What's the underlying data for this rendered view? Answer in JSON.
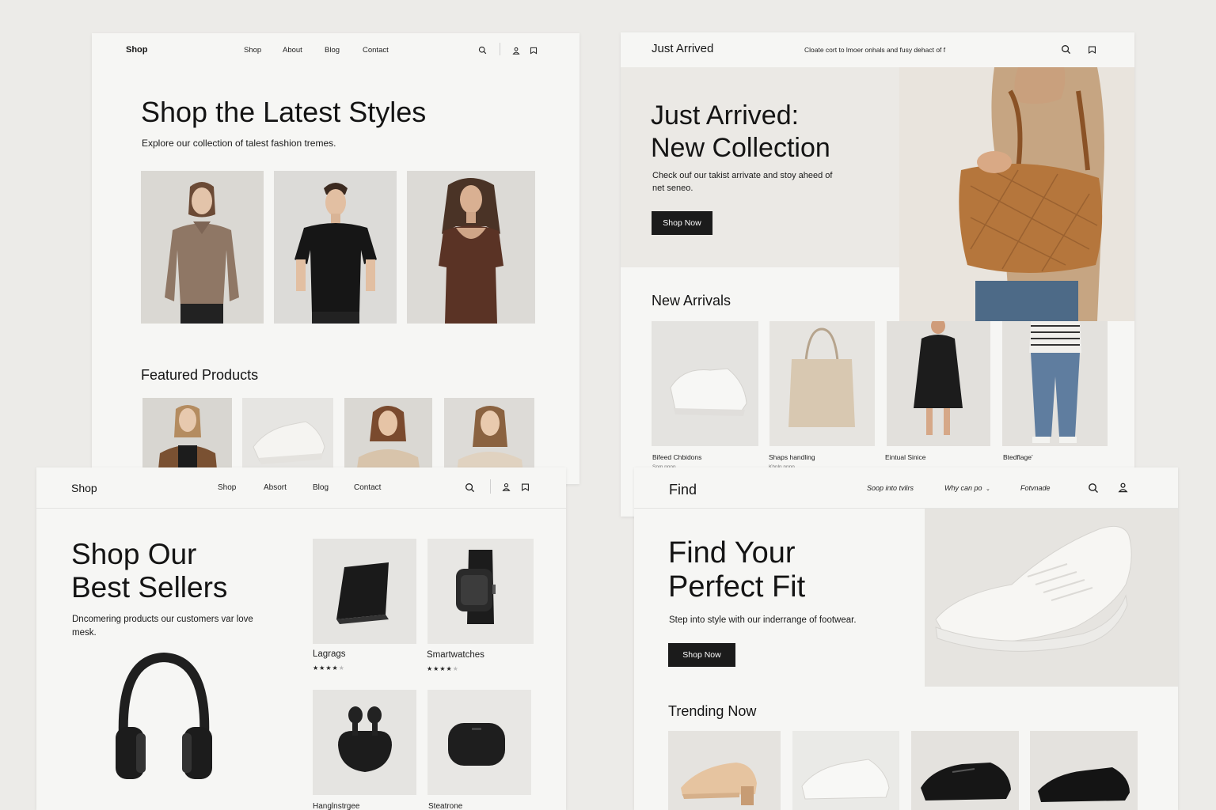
{
  "panel1": {
    "logo": "Shop",
    "nav": [
      "Shop",
      "About",
      "Blog",
      "Contact"
    ],
    "title": "Shop the Latest Styles",
    "subtitle": "Explore our collection of talest fashion tremes.",
    "featured_title": "Featured Products"
  },
  "panel2": {
    "logo": "Just Arrived",
    "tagline": "Cloate cort to lmoer onhals and fusy dehact of f",
    "title_line1": "Just Arrived:",
    "title_line2": "New Collection",
    "subtitle": "Check ouf our takist arrivate and stoy aheed of net seneo.",
    "button": "Shop Now",
    "section_title": "New Arrivals",
    "products": [
      {
        "name": "Bifeed Chbidons",
        "sub": "Snm nnnn"
      },
      {
        "name": "Shaps handling",
        "sub": "Khnln nnnn"
      },
      {
        "name": "Eintual Sinice",
        "sub": ""
      },
      {
        "name": "Btedflage’",
        "sub": ""
      }
    ]
  },
  "panel3": {
    "logo": "Shop",
    "nav": [
      "Shop",
      "Absort",
      "Blog",
      "Contact"
    ],
    "title_line1": "Shop Our",
    "title_line2": "Best Sellers",
    "subtitle": "Dncomering products our customers var love mesk.",
    "products": [
      {
        "name": "Lagrags",
        "rating": 4
      },
      {
        "name": "Smartwatches",
        "rating": 4
      },
      {
        "name": "Hanglnstrgee",
        "rating": 0
      },
      {
        "name": "Steatrone",
        "rating": 0
      }
    ]
  },
  "panel4": {
    "logo": "Find",
    "nav": [
      "Soop into tvlirs",
      "Why can po",
      "Fotvnade"
    ],
    "title_line1": "Find Your",
    "title_line2": "Perfect Fit",
    "subtitle": "Step into style with our inderrange of footwear.",
    "button": "Shop Now",
    "section_title": "Trending Now"
  },
  "colors": {
    "background": "#ecebe8",
    "panel": "#f6f6f4",
    "button": "#1b1b1b",
    "image_bg": "#dcdbd7"
  }
}
